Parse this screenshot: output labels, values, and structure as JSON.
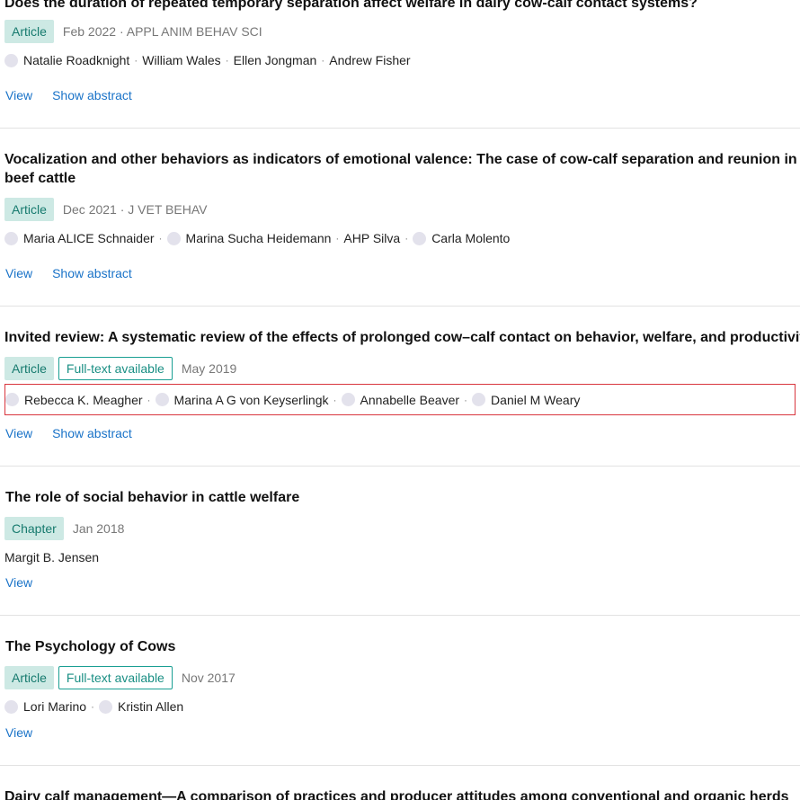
{
  "publications": [
    {
      "title": "Does the duration of repeated temporary separation affect welfare in dairy cow-calf contact systems?",
      "type": "Article",
      "meta": "Feb 2022 · APPL ANIM BEHAV SCI",
      "authors": [
        "Natalie Roadknight",
        "William Wales",
        "Ellen Jongman",
        "Andrew Fisher"
      ],
      "view": "View",
      "abstract": "Show abstract"
    },
    {
      "title_line1": "Vocalization and other behaviors as indicators of emotional valence: The case of cow-calf separation and reunion in",
      "title_line2": "beef cattle",
      "type": "Article",
      "meta": "Dec 2021 · J VET BEHAV",
      "authors": [
        "Maria ALICE Schnaider",
        "Marina Sucha Heidemann",
        "AHP Silva",
        "Carla Molento"
      ],
      "view": "View",
      "abstract": "Show abstract"
    },
    {
      "title": "Invited review: A systematic review of the effects of prolonged cow–calf contact on behavior, welfare, and productivity",
      "type": "Article",
      "fulltext": "Full-text available",
      "meta": "May 2019",
      "authors": [
        "Rebecca K. Meagher",
        "Marina A G von Keyserlingk",
        "Annabelle Beaver",
        "Daniel M Weary"
      ],
      "view": "View",
      "abstract": "Show abstract"
    },
    {
      "title": "The role of social behavior in cattle welfare",
      "type": "Chapter",
      "meta": "Jan 2018",
      "authors_text": "Margit B. Jensen",
      "view": "View"
    },
    {
      "title": "The Psychology of Cows",
      "type": "Article",
      "fulltext": "Full-text available",
      "meta": "Nov 2017",
      "authors": [
        "Lori Marino",
        "Kristin Allen"
      ],
      "view": "View"
    },
    {
      "title": "Dairy calf management—A comparison of practices and producer attitudes among conventional and organic herds"
    }
  ],
  "separator": "·",
  "colors": {
    "link": "#1a73c8",
    "badge_bg": "#cde9e4",
    "badge_text": "#167a6e",
    "fulltext_border": "#1a9f93",
    "highlight_border": "#d9363e",
    "avatar": "#e3e2ec"
  }
}
